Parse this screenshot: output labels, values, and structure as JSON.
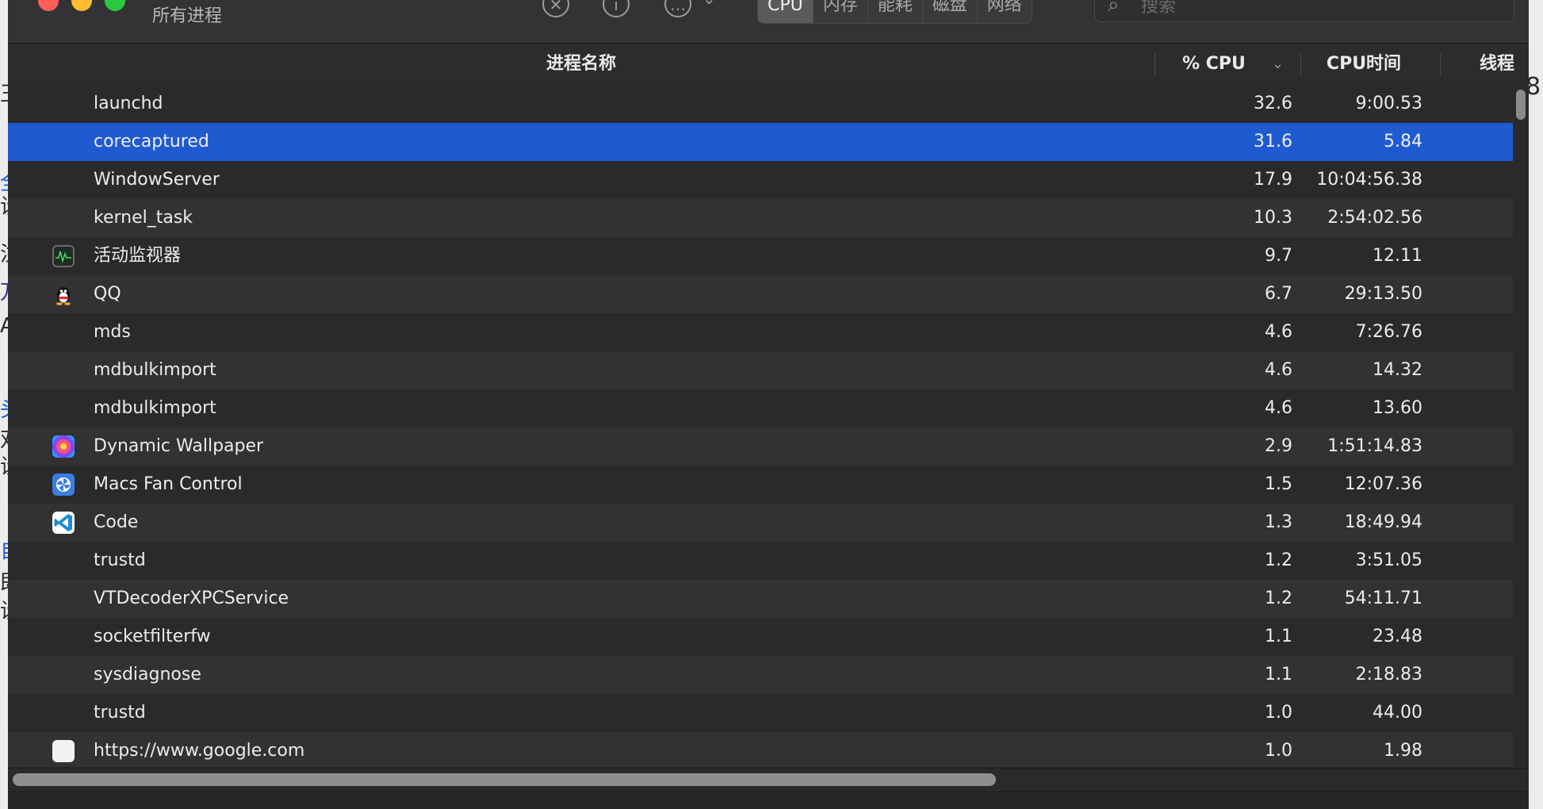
{
  "window": {
    "subtitle": "所有进程"
  },
  "toolbar": {
    "tabs": [
      {
        "label": "CPU",
        "active": true
      },
      {
        "label": "内存"
      },
      {
        "label": "能耗"
      },
      {
        "label": "磁盘"
      },
      {
        "label": "网络"
      }
    ],
    "search_placeholder": "搜索",
    "stop_glyph": "✕",
    "info_glyph": "i",
    "more_glyph": "…",
    "chevron_glyph": "⌄"
  },
  "columns": {
    "name": "进程名称",
    "cpu": "% CPU",
    "cpu_time": "CPU时间",
    "threads": "线程"
  },
  "processes": [
    {
      "name": "launchd",
      "cpu": "32.6",
      "time": "9:00.53",
      "icon": ""
    },
    {
      "name": "corecaptured",
      "cpu": "31.6",
      "time": "5.84",
      "icon": "",
      "selected": true
    },
    {
      "name": "WindowServer",
      "cpu": "17.9",
      "time": "10:04:56.38",
      "icon": ""
    },
    {
      "name": "kernel_task",
      "cpu": "10.3",
      "time": "2:54:02.56",
      "icon": ""
    },
    {
      "name": "活动监视器",
      "cpu": "9.7",
      "time": "12.11",
      "icon": "activity-monitor-icon"
    },
    {
      "name": "QQ",
      "cpu": "6.7",
      "time": "29:13.50",
      "icon": "qq-penguin-icon"
    },
    {
      "name": "mds",
      "cpu": "4.6",
      "time": "7:26.76",
      "icon": ""
    },
    {
      "name": "mdbulkimport",
      "cpu": "4.6",
      "time": "14.32",
      "icon": ""
    },
    {
      "name": "mdbulkimport",
      "cpu": "4.6",
      "time": "13.60",
      "icon": ""
    },
    {
      "name": "Dynamic Wallpaper",
      "cpu": "2.9",
      "time": "1:51:14.83",
      "icon": "dynamic-wallpaper-icon"
    },
    {
      "name": "Macs Fan Control",
      "cpu": "1.5",
      "time": "12:07.36",
      "icon": "macs-fan-control-icon"
    },
    {
      "name": "Code",
      "cpu": "1.3",
      "time": "18:49.94",
      "icon": "vscode-icon"
    },
    {
      "name": "trustd",
      "cpu": "1.2",
      "time": "3:51.05",
      "icon": ""
    },
    {
      "name": "VTDecoderXPCService",
      "cpu": "1.2",
      "time": "54:11.71",
      "icon": ""
    },
    {
      "name": "socketfilterfw",
      "cpu": "1.1",
      "time": "23.48",
      "icon": ""
    },
    {
      "name": "sysdiagnose",
      "cpu": "1.1",
      "time": "2:18.83",
      "icon": ""
    },
    {
      "name": "trustd",
      "cpu": "1.0",
      "time": "44.00",
      "icon": ""
    },
    {
      "name": "https://www.google.com",
      "cpu": "1.0",
      "time": "1.98",
      "icon": "google-chrome-helper-icon"
    }
  ],
  "colors": {
    "selected_row": "#1f5ad1",
    "row_odd": "#2a2a2c",
    "row_even": "#323234"
  }
}
